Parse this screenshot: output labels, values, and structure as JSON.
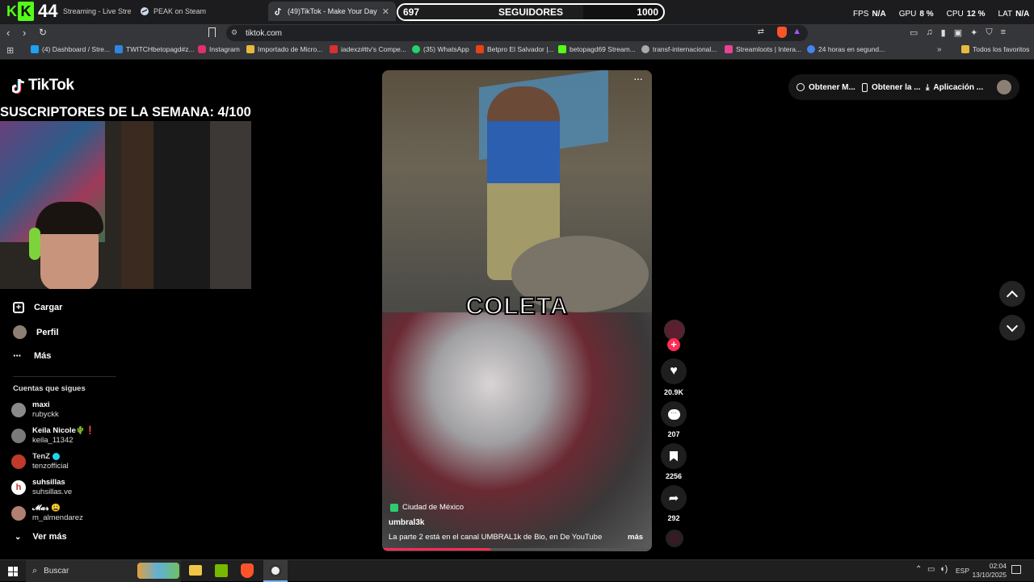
{
  "tabs": [
    {
      "label": "Streaming - Live Stream"
    },
    {
      "label": "PEAK on Steam"
    },
    {
      "label": "(49)TikTok - Make Your Day"
    }
  ],
  "overlay": {
    "k_count": "44",
    "followers_current": "697",
    "followers_label": "SEGUIDORES",
    "followers_goal": "1000",
    "followers_progress": 0.697,
    "stats": {
      "fps_label": "FPS",
      "fps_value": "N/A",
      "gpu_label": "GPU",
      "gpu_value": "8 %",
      "cpu_label": "CPU",
      "cpu_value": "12 %",
      "lat_label": "LAT",
      "lat_value": "N/A"
    },
    "subs_banner": "SUSCRIPTORES DE LA SEMANA: 4/100"
  },
  "address": {
    "url": "tiktok.com"
  },
  "bookmarks": [
    {
      "label": "(4) Dashboard / Stre...",
      "color": "#1da1f2"
    },
    {
      "label": "TWITCHbetopagd#z...",
      "color": "#2e86de"
    },
    {
      "label": "Instagram",
      "color": "#e1306c"
    },
    {
      "label": "Importado de Micro...",
      "color": "#e8b93c"
    },
    {
      "label": "iadexz#ttv's Compe...",
      "color": "#d63031"
    },
    {
      "label": "(35) WhatsApp",
      "color": "#25d366"
    },
    {
      "label": "Betpro El Salvador |...",
      "color": "#e84118"
    },
    {
      "label": "betopagd69 Stream...",
      "color": "#53fc18"
    },
    {
      "label": "transf-internacional...",
      "color": "#aaaaaa"
    },
    {
      "label": "Streamloots | Intera...",
      "color": "#e84393"
    },
    {
      "label": "24 horas en segund...",
      "color": "#4285f4"
    },
    {
      "label": "Todos los favoritos",
      "color": "#e8b93c"
    }
  ],
  "tiktok": {
    "logo": "TikTok",
    "nav": [
      {
        "label": "Cargar",
        "icon": "plus-square-icon"
      },
      {
        "label": "Perfil",
        "icon": "avatar-icon"
      },
      {
        "label": "Más",
        "icon": "more-icon"
      }
    ],
    "following_header": "Cuentas que sigues",
    "following": [
      {
        "name": "maxi",
        "handle": "rubyckk",
        "color": "#8a8a8a"
      },
      {
        "name": "Keila Nicole🌵❗",
        "handle": "keila_11342",
        "color": "#7a7a7a"
      },
      {
        "name": "TenZ",
        "handle": "tenzofficial",
        "color": "#c0392b"
      },
      {
        "name": "suhsillas",
        "handle": "suhsillas.ve",
        "color": "#ffffff"
      },
      {
        "name": "𝓜𝓪𝓻 😩",
        "handle": "m_almendarez",
        "color": "#b08070"
      }
    ],
    "see_more": "Ver más",
    "top_buttons": {
      "coins": "Obtener M...",
      "app": "Obtener la ...",
      "desktop": "Aplicación ..."
    },
    "video": {
      "overlay_text": "COLETA",
      "location": "Ciudad de México",
      "author": "umbral3k",
      "caption": "La parte 2 está en el canal UMBRAL1k de Bio, en De YouTube",
      "more": "más"
    },
    "actions": {
      "likes": "20.9K",
      "comments": "207",
      "saves": "2256",
      "shares": "292"
    }
  },
  "taskbar": {
    "search_placeholder": "Buscar",
    "lang": "ESP",
    "time": "02:04",
    "date": "13/10/2025"
  }
}
